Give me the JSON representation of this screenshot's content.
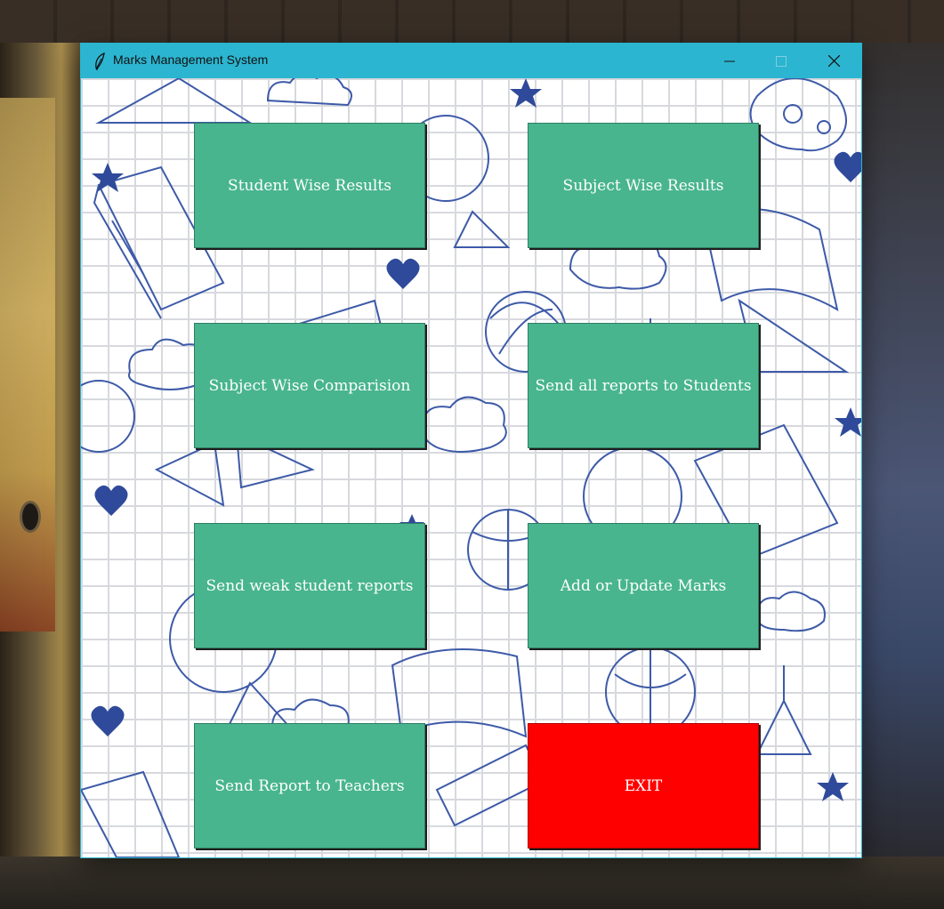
{
  "window": {
    "title": "Marks Management System",
    "app_icon": "feather-icon",
    "controls": [
      "minimize-icon",
      "maximize-icon",
      "close-icon"
    ]
  },
  "colors": {
    "titlebar": "#2cb5d0",
    "button_green": "#48b58f",
    "button_exit": "#ff0000",
    "doodle_ink": "#2f4a9a"
  },
  "buttons": {
    "student_wise_results": "Student Wise Results",
    "subject_wise_results": "Subject Wise Results",
    "subject_wise_comparision": "Subject Wise Comparision",
    "send_all_reports": "Send all reports to Students",
    "send_weak_reports": "Send weak student reports",
    "add_update_marks": "Add or Update Marks",
    "send_report_teachers": "Send Report to Teachers",
    "exit": "EXIT"
  }
}
